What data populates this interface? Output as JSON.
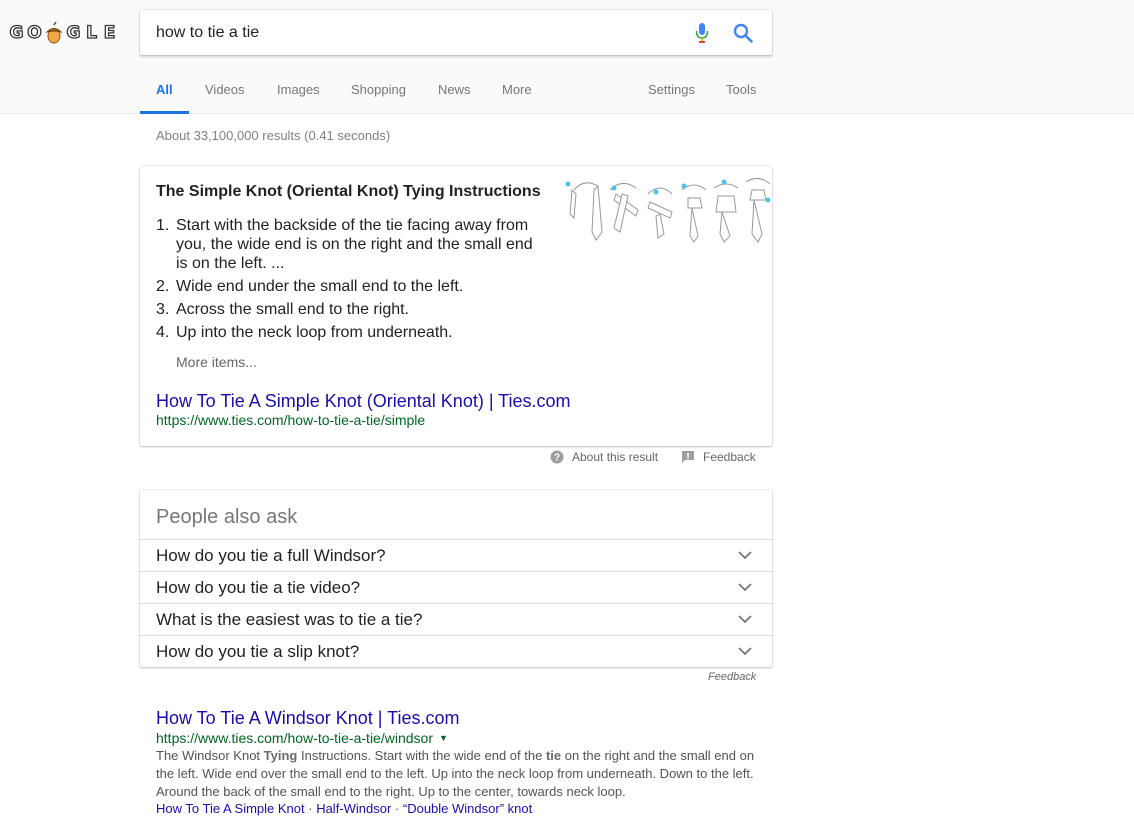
{
  "logo": {
    "letters": [
      "G",
      "O",
      "G",
      "L",
      "E"
    ]
  },
  "search": {
    "query": "how to tie a tie"
  },
  "tabs": {
    "all": "All",
    "videos": "Videos",
    "images": "Images",
    "shopping": "Shopping",
    "news": "News",
    "more": "More",
    "settings": "Settings",
    "tools": "Tools"
  },
  "stats": "About 33,100,000 results (0.41 seconds)",
  "snippet": {
    "title": "The Simple Knot (Oriental Knot) Tying Instructions",
    "steps": [
      {
        "num": "1.",
        "text": "Start with the backside of the tie facing away from you, the wide end is on the right and the small end is on the left. ..."
      },
      {
        "num": "2.",
        "text": "Wide end under the small end to the left."
      },
      {
        "num": "3.",
        "text": "Across the small end to the right."
      },
      {
        "num": "4.",
        "text": "Up into the neck loop from underneath."
      }
    ],
    "more_items": "More items...",
    "link": "How To Tie A Simple Knot (Oriental Knot) | Ties.com",
    "url": "https://www.ties.com/how-to-tie-a-tie/simple",
    "image_steps": [
      "1",
      "2",
      "3",
      "4",
      "5",
      "6"
    ]
  },
  "meta": {
    "about": "About this result",
    "feedback": "Feedback"
  },
  "paa": {
    "title": "People also ask",
    "questions": [
      "How do you tie a full Windsor?",
      "How do you tie a tie video?",
      "What is the easiest was to tie a tie?",
      "How do you tie a slip knot?"
    ],
    "feedback": "Feedback"
  },
  "result2": {
    "link": "How To Tie A Windsor Knot | Ties.com",
    "url": "https://www.ties.com/how-to-tie-a-tie/windsor",
    "desc_1": "The Windsor Knot ",
    "desc_b1": "Tying",
    "desc_2": " Instructions. Start with the wide end of the ",
    "desc_b2": "tie",
    "desc_3": " on the right and the small end on the left. Wide end over the small end to the left. Up into the neck loop from underneath. Down to the left. Around the back of the small end to the right. Up to the center, towards neck loop.",
    "sitelinks": [
      "How To Tie A Simple Knot",
      "Half-Windsor",
      "“Double Windsor” knot"
    ],
    "separator": " · "
  },
  "colors": {
    "link": "#1a0dab",
    "url": "#006621",
    "active_tab": "#1a73e8",
    "mic_blue": "#4285f4",
    "mic_red": "#ea4335",
    "search_blue": "#4285f4"
  }
}
